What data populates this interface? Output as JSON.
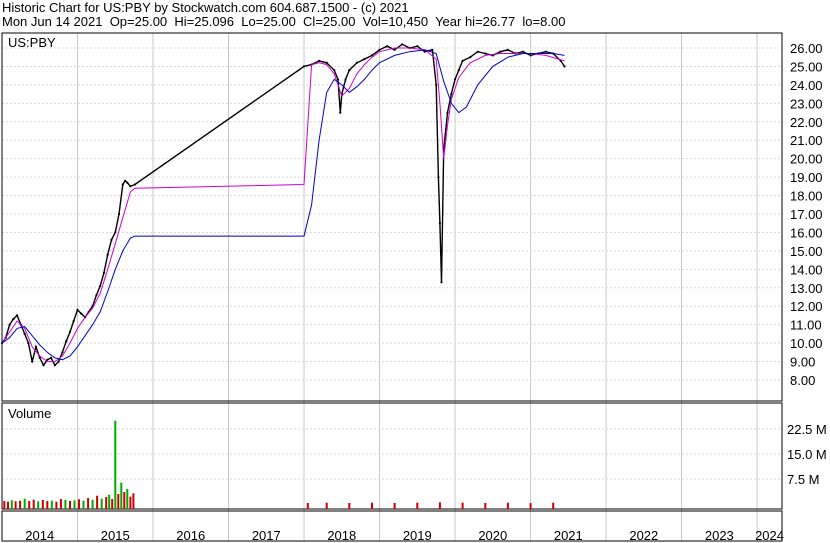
{
  "header": {
    "line1": "Historic Chart for US:PBY by Stockwatch.com 604.687.1500 - (c) 2021",
    "line2": "Mon Jun 14 2021  Op=25.00  Hi=25.096  Lo=25.00  Cl=25.00  Vol=10,450  Year hi=26.77  lo=8.00"
  },
  "chart_data": [
    {
      "type": "line",
      "label": "US:PBY",
      "y_ticks": [
        "26.00",
        "25.00",
        "24.00",
        "23.00",
        "22.00",
        "21.00",
        "20.00",
        "19.00",
        "18.00",
        "17.00",
        "16.00",
        "15.00",
        "14.00",
        "13.00",
        "12.00",
        "11.00",
        "10.00",
        "9.00",
        "8.00"
      ],
      "ylim": [
        7.0,
        26.7
      ],
      "xlim": [
        2014.0,
        2024.33
      ],
      "colors": {
        "price": "#000000",
        "ma_short": "#cc00cc",
        "ma_long": "#0000cc"
      },
      "series": [
        {
          "role": "price",
          "x": [
            2014.0,
            2014.05,
            2014.1,
            2014.15,
            2014.2,
            2014.25,
            2014.3,
            2014.35,
            2014.4,
            2014.45,
            2014.5,
            2014.55,
            2014.6,
            2014.65,
            2014.7,
            2014.75,
            2014.8,
            2014.85,
            2014.9,
            2014.95,
            2015.0,
            2015.05,
            2015.1,
            2015.15,
            2015.2,
            2015.25,
            2015.3,
            2015.35,
            2015.4,
            2015.45,
            2015.5,
            2015.55,
            2015.6,
            2015.63,
            2015.66,
            2015.7,
            2015.76,
            2018.0,
            2018.1,
            2018.2,
            2018.3,
            2018.4,
            2018.45,
            2018.48,
            2018.5,
            2018.55,
            2018.6,
            2018.7,
            2018.8,
            2018.9,
            2019.0,
            2019.1,
            2019.2,
            2019.3,
            2019.4,
            2019.5,
            2019.6,
            2019.7,
            2019.75,
            2019.78,
            2019.8,
            2019.82,
            2019.85,
            2019.9,
            2019.95,
            2020.0,
            2020.05,
            2020.1,
            2020.2,
            2020.3,
            2020.4,
            2020.5,
            2020.6,
            2020.7,
            2020.8,
            2020.9,
            2021.0,
            2021.1,
            2021.2,
            2021.3,
            2021.4,
            2021.45
          ],
          "y": [
            10.0,
            10.3,
            11.0,
            11.3,
            11.5,
            11.0,
            10.5,
            10.0,
            9.0,
            9.8,
            9.2,
            8.8,
            9.1,
            9.2,
            8.8,
            9.0,
            9.5,
            10.1,
            10.6,
            11.2,
            11.8,
            11.6,
            11.4,
            11.7,
            12.0,
            12.6,
            13.1,
            13.8,
            14.8,
            15.6,
            16.0,
            17.0,
            18.6,
            18.8,
            18.7,
            18.5,
            18.6,
            25.0,
            25.1,
            25.3,
            25.2,
            24.8,
            24.3,
            22.5,
            23.5,
            24.3,
            24.8,
            25.2,
            25.4,
            25.6,
            25.9,
            26.1,
            25.9,
            26.2,
            26.0,
            26.1,
            25.8,
            25.9,
            24.0,
            19.0,
            16.5,
            13.3,
            20.5,
            22.5,
            23.5,
            24.3,
            24.8,
            25.3,
            25.5,
            25.8,
            25.7,
            25.6,
            25.8,
            25.9,
            25.7,
            25.8,
            25.6,
            25.7,
            25.8,
            25.7,
            25.3,
            25.0
          ]
        },
        {
          "role": "ma_short",
          "x": [
            2014.0,
            2014.1,
            2014.2,
            2014.3,
            2014.4,
            2014.5,
            2014.6,
            2014.7,
            2014.8,
            2014.9,
            2015.0,
            2015.1,
            2015.2,
            2015.3,
            2015.4,
            2015.5,
            2015.6,
            2015.7,
            2015.76,
            2018.0,
            2018.1,
            2018.2,
            2018.3,
            2018.4,
            2018.5,
            2018.6,
            2018.7,
            2018.8,
            2018.9,
            2019.0,
            2019.2,
            2019.4,
            2019.6,
            2019.75,
            2019.8,
            2019.85,
            2019.9,
            2019.95,
            2020.05,
            2020.2,
            2020.4,
            2020.6,
            2020.8,
            2021.0,
            2021.2,
            2021.45
          ],
          "y": [
            10.0,
            10.6,
            11.2,
            10.8,
            9.8,
            9.3,
            9.0,
            9.0,
            9.3,
            10.0,
            10.8,
            11.4,
            11.9,
            12.7,
            14.0,
            15.4,
            16.8,
            18.2,
            18.4,
            18.6,
            25.1,
            25.2,
            25.1,
            24.6,
            23.4,
            23.8,
            24.6,
            25.1,
            25.5,
            25.8,
            26.0,
            26.0,
            25.9,
            25.4,
            23.0,
            20.0,
            21.8,
            23.2,
            24.4,
            25.2,
            25.6,
            25.7,
            25.7,
            25.7,
            25.6,
            25.3
          ]
        },
        {
          "role": "ma_long",
          "x": [
            2014.0,
            2014.1,
            2014.2,
            2014.3,
            2014.4,
            2014.5,
            2014.6,
            2014.7,
            2014.8,
            2014.9,
            2015.0,
            2015.1,
            2015.2,
            2015.3,
            2015.4,
            2015.5,
            2015.6,
            2015.7,
            2015.76,
            2018.0,
            2018.1,
            2018.2,
            2018.3,
            2018.4,
            2018.5,
            2018.6,
            2018.7,
            2018.8,
            2018.9,
            2019.0,
            2019.2,
            2019.4,
            2019.6,
            2019.75,
            2019.85,
            2019.95,
            2020.05,
            2020.15,
            2020.3,
            2020.5,
            2020.7,
            2020.9,
            2021.1,
            2021.3,
            2021.45
          ],
          "y": [
            10.0,
            10.3,
            10.8,
            10.9,
            10.4,
            9.9,
            9.5,
            9.2,
            9.1,
            9.3,
            9.8,
            10.4,
            11.0,
            11.7,
            12.8,
            14.0,
            15.0,
            15.7,
            15.8,
            15.8,
            17.5,
            21.0,
            23.6,
            24.3,
            24.0,
            23.6,
            23.9,
            24.3,
            24.8,
            25.2,
            25.6,
            25.8,
            25.9,
            25.7,
            24.2,
            23.0,
            22.5,
            22.8,
            24.0,
            25.0,
            25.5,
            25.7,
            25.7,
            25.7,
            25.6
          ]
        }
      ]
    },
    {
      "type": "bar",
      "label": "Volume",
      "y_ticks": [
        "22.5 M",
        "15.0 M",
        "7.5 M"
      ],
      "ylim": [
        0,
        27.5
      ],
      "x_ticks": [
        "2014",
        "2015",
        "2016",
        "2017",
        "2018",
        "2019",
        "2020",
        "2021",
        "2022",
        "2023",
        "2024"
      ],
      "x_tick_positions": [
        2014,
        2015,
        2016,
        2017,
        2018,
        2019,
        2020,
        2021,
        2022,
        2023,
        2024
      ],
      "colors": {
        "up": "#00aa00",
        "down": "#cc0000"
      },
      "bars": [
        {
          "x": 2014.03,
          "v": 0.9,
          "c": "down"
        },
        {
          "x": 2014.08,
          "v": 0.7,
          "c": "down"
        },
        {
          "x": 2014.13,
          "v": 1.1,
          "c": "up"
        },
        {
          "x": 2014.18,
          "v": 0.8,
          "c": "down"
        },
        {
          "x": 2014.24,
          "v": 1.0,
          "c": "down"
        },
        {
          "x": 2014.3,
          "v": 1.6,
          "c": "up"
        },
        {
          "x": 2014.36,
          "v": 0.9,
          "c": "down"
        },
        {
          "x": 2014.42,
          "v": 1.3,
          "c": "down"
        },
        {
          "x": 2014.48,
          "v": 0.8,
          "c": "up"
        },
        {
          "x": 2014.54,
          "v": 1.2,
          "c": "down"
        },
        {
          "x": 2014.6,
          "v": 0.9,
          "c": "down"
        },
        {
          "x": 2014.66,
          "v": 1.0,
          "c": "up"
        },
        {
          "x": 2014.72,
          "v": 0.7,
          "c": "down"
        },
        {
          "x": 2014.78,
          "v": 1.5,
          "c": "down"
        },
        {
          "x": 2014.84,
          "v": 1.2,
          "c": "up"
        },
        {
          "x": 2014.9,
          "v": 0.9,
          "c": "down"
        },
        {
          "x": 2014.96,
          "v": 1.1,
          "c": "up"
        },
        {
          "x": 2015.02,
          "v": 1.4,
          "c": "down"
        },
        {
          "x": 2015.08,
          "v": 1.0,
          "c": "up"
        },
        {
          "x": 2015.14,
          "v": 1.8,
          "c": "down"
        },
        {
          "x": 2015.2,
          "v": 1.3,
          "c": "up"
        },
        {
          "x": 2015.26,
          "v": 2.5,
          "c": "down"
        },
        {
          "x": 2015.32,
          "v": 1.6,
          "c": "up"
        },
        {
          "x": 2015.38,
          "v": 2.1,
          "c": "down"
        },
        {
          "x": 2015.42,
          "v": 2.8,
          "c": "up"
        },
        {
          "x": 2015.46,
          "v": 1.5,
          "c": "down"
        },
        {
          "x": 2015.5,
          "v": 25.0,
          "c": "up"
        },
        {
          "x": 2015.54,
          "v": 3.0,
          "c": "down"
        },
        {
          "x": 2015.58,
          "v": 6.4,
          "c": "up"
        },
        {
          "x": 2015.62,
          "v": 3.6,
          "c": "down"
        },
        {
          "x": 2015.66,
          "v": 4.5,
          "c": "up"
        },
        {
          "x": 2015.7,
          "v": 2.2,
          "c": "down"
        },
        {
          "x": 2015.74,
          "v": 3.2,
          "c": "down"
        },
        {
          "x": 2018.05,
          "v": 0.3,
          "c": "down"
        },
        {
          "x": 2018.3,
          "v": 0.4,
          "c": "down"
        },
        {
          "x": 2018.6,
          "v": 0.3,
          "c": "down"
        },
        {
          "x": 2018.9,
          "v": 0.4,
          "c": "down"
        },
        {
          "x": 2019.2,
          "v": 0.3,
          "c": "down"
        },
        {
          "x": 2019.5,
          "v": 0.4,
          "c": "down"
        },
        {
          "x": 2019.8,
          "v": 0.5,
          "c": "down"
        },
        {
          "x": 2020.1,
          "v": 0.4,
          "c": "down"
        },
        {
          "x": 2020.4,
          "v": 0.3,
          "c": "down"
        },
        {
          "x": 2020.7,
          "v": 0.4,
          "c": "down"
        },
        {
          "x": 2021.0,
          "v": 0.3,
          "c": "down"
        },
        {
          "x": 2021.3,
          "v": 0.4,
          "c": "down"
        }
      ]
    }
  ]
}
